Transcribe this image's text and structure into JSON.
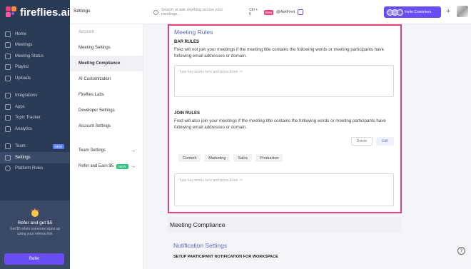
{
  "app": {
    "name": "fireflies.ai"
  },
  "nav": {
    "items": [
      {
        "label": "Home",
        "icon": "home-icon"
      },
      {
        "label": "Meetings",
        "icon": "video-icon"
      },
      {
        "label": "Meeting Status",
        "icon": "pulse-icon"
      },
      {
        "label": "Playlist",
        "icon": "playlist-icon"
      },
      {
        "label": "Uploads",
        "icon": "upload-icon"
      }
    ],
    "items2": [
      {
        "label": "Integrations",
        "icon": "integrations-icon"
      },
      {
        "label": "Apps",
        "icon": "apps-icon"
      },
      {
        "label": "Topic Tracker",
        "icon": "hash-icon"
      },
      {
        "label": "Analytics",
        "icon": "analytics-icon"
      }
    ],
    "items3": [
      {
        "label": "Team",
        "icon": "team-icon",
        "badge": "NEW"
      },
      {
        "label": "Settings",
        "icon": "gear-icon"
      },
      {
        "label": "Platform Rules",
        "icon": "info-icon"
      }
    ]
  },
  "promo": {
    "title": "Refer and get $5",
    "subtitle": "Get $5 when someone signs up using your referral link",
    "button": "Refer"
  },
  "topbar": {
    "title": "Settings",
    "search_placeholder": "Search or ask anything across your meetings...",
    "shortcut": "Ctrl + K",
    "beta": "Beta",
    "askfred": "@AskFred",
    "invite": "Invite Coworkers",
    "plus": "+"
  },
  "settings_nav": {
    "header": "Account",
    "items": [
      "Meeting Settings",
      "Meeting Compliance",
      "AI Customization",
      "Fireflies Labs",
      "Developer Settings",
      "Account Settings"
    ],
    "team_settings": "Team Settings",
    "refer": "Refer and Earn $5",
    "refer_badge": "NEW",
    "arrow": "→"
  },
  "meeting_rules": {
    "title": "Meeting Rules",
    "bar_label": "BAR RULES",
    "bar_desc": "Fred will not join your meetings if the meeting title contains the following words or meeting participants have following email addresses or domain.",
    "bar_placeholder": "Type key words here and press Enter ⏎",
    "join_label": "JOIN RULES",
    "join_desc": "Fred will also join your meetings if the meeting title contains the following words or meeting participants have following email addresses or domain.",
    "delete": "Delete",
    "edit": "Edit",
    "chips": [
      "Content",
      "Marketing",
      "Sales",
      "Production"
    ],
    "join_placeholder": "Type key words here and press Enter ⏎"
  },
  "compliance": {
    "title": "Meeting Compliance"
  },
  "notifications": {
    "title": "Notification Settings",
    "subtitle": "SETUP PARTICIPANT NOTIFICATION FOR WORKSPACE"
  },
  "help": "?",
  "colors": {
    "sidebar": "#2b3a55",
    "accent": "#6b4df5",
    "highlight": "#e8407e",
    "heading": "#5b6bb8"
  }
}
